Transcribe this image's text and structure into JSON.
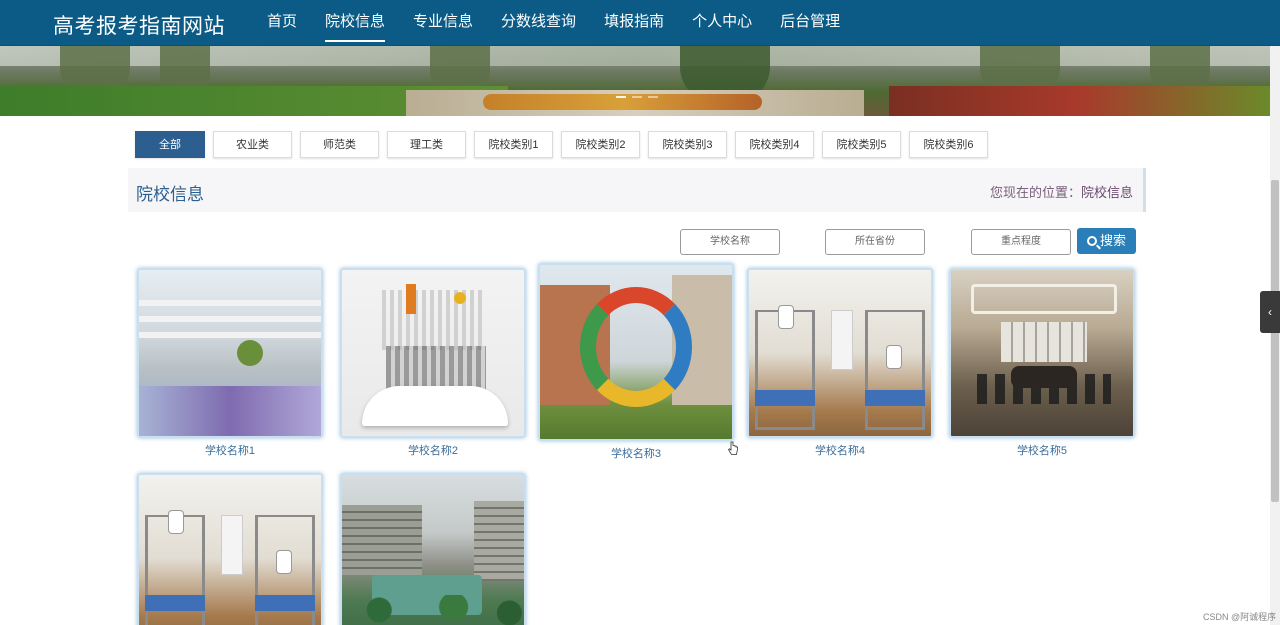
{
  "site": {
    "brand": "高考报考指南网站"
  },
  "nav": [
    {
      "label": "首页",
      "active": false
    },
    {
      "label": "院校信息",
      "active": true
    },
    {
      "label": "专业信息",
      "active": false
    },
    {
      "label": "分数线查询",
      "active": false
    },
    {
      "label": "填报指南",
      "active": false
    },
    {
      "label": "个人中心",
      "active": false
    },
    {
      "label": "后台管理",
      "active": false
    }
  ],
  "categories": [
    {
      "label": "全部",
      "active": true
    },
    {
      "label": "农业类"
    },
    {
      "label": "师范类"
    },
    {
      "label": "理工类"
    },
    {
      "label": "院校类别1"
    },
    {
      "label": "院校类别2"
    },
    {
      "label": "院校类别3"
    },
    {
      "label": "院校类别4"
    },
    {
      "label": "院校类别5"
    },
    {
      "label": "院校类别6"
    }
  ],
  "section": {
    "title": "院校信息",
    "breadcrumb_prefix": "您现在的位置：",
    "breadcrumb_current": "院校信息"
  },
  "search": {
    "school_name_placeholder": "学校名称",
    "province_placeholder": "所在省份",
    "key_level_placeholder": "重点程度",
    "button_label": "搜索"
  },
  "schools": [
    {
      "name": "学校名称1",
      "image": "modern-building-courtyard"
    },
    {
      "name": "学校名称2",
      "image": "open-book-infographic"
    },
    {
      "name": "学校名称3",
      "image": "ring-sculpture-campus"
    },
    {
      "name": "学校名称4",
      "image": "dormitory-bunks"
    },
    {
      "name": "学校名称5",
      "image": "meeting-room"
    },
    {
      "name": "",
      "image": "dormitory-bunks"
    },
    {
      "name": "",
      "image": "campus-aerial"
    }
  ],
  "side_toggle": "‹",
  "watermark": "CSDN @阿诚程序",
  "colors": {
    "navbar": "#0b5b86",
    "accent": "#2a7fb8",
    "category_active": "#2c5f8f"
  }
}
